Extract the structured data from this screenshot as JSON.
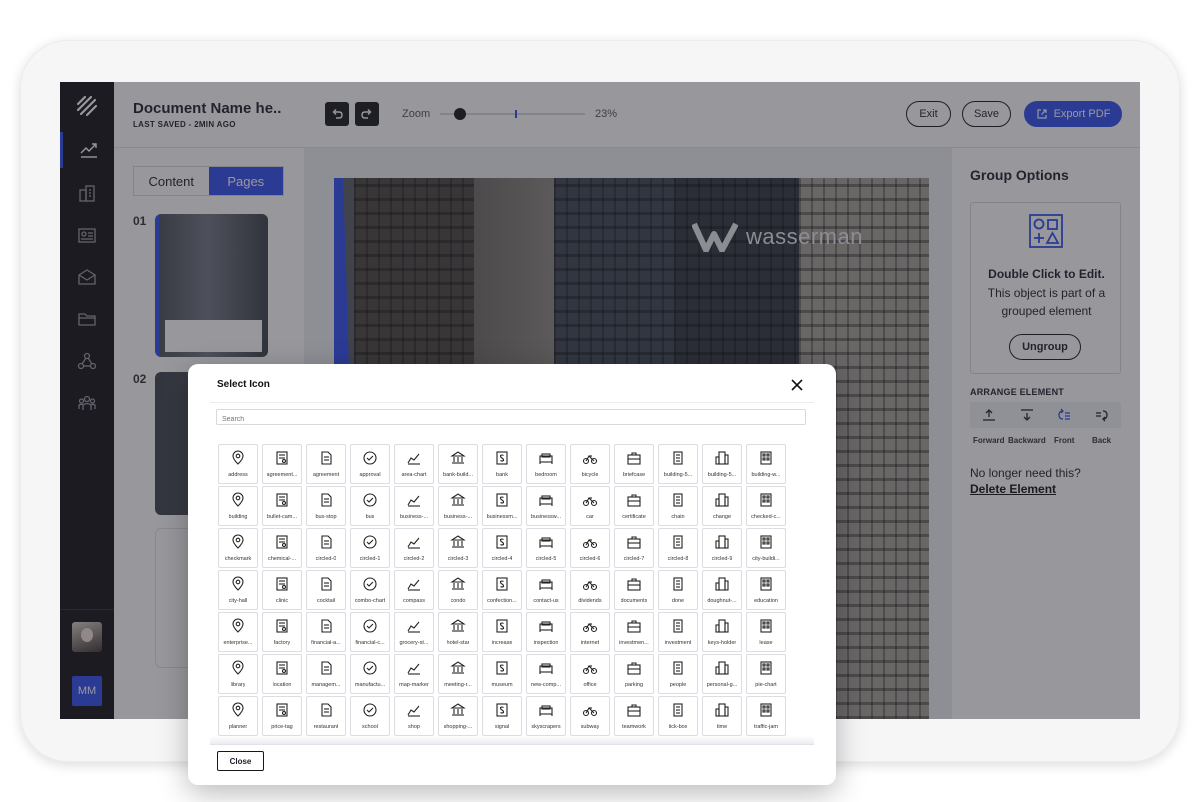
{
  "document": {
    "title": "Document Name he..",
    "saved": "LAST SAVED - 2MIN AGO"
  },
  "toolbar": {
    "undo_icon": "undo-icon",
    "redo_icon": "redo-icon",
    "zoom_label": "Zoom",
    "zoom_value": "23%",
    "zoom_fraction": 0.23,
    "exit": "Exit",
    "save": "Save",
    "export": "Export PDF"
  },
  "sidebar": {
    "initials": "MM",
    "items": [
      "analytics-icon",
      "buildings-icon",
      "listing-icon",
      "mail-icon",
      "folder-icon",
      "network-icon",
      "team-icon"
    ]
  },
  "left_panel": {
    "tabs": [
      "Content",
      "Pages"
    ],
    "active_tab": "Pages",
    "page_numbers": [
      "01",
      "02"
    ]
  },
  "canvas": {
    "brand": "wasserman"
  },
  "group_options": {
    "title": "Group Options",
    "edit_title": "Double Click to Edit.",
    "edit_desc": "This object is part of a grouped element",
    "ungroup": "Ungroup",
    "arrange_title": "ARRANGE ELEMENT",
    "arrange": [
      "Forward",
      "Backward",
      "Front",
      "Back"
    ],
    "no_longer": "No longer need this?",
    "delete": "Delete Element"
  },
  "modal": {
    "title": "Select Icon",
    "search_placeholder": "Search",
    "close_button": "Close",
    "icons": [
      "address",
      "agreement...",
      "agreement",
      "approval",
      "area-chart",
      "bank-build...",
      "bank",
      "bedroom",
      "bicycle",
      "briefcase",
      "building-5...",
      "building-5...",
      "building-w...",
      "building",
      "bullet-cam...",
      "bus-stop",
      "bus",
      "business-...",
      "business-...",
      "businessm...",
      "businessw...",
      "car",
      "certificate",
      "chain",
      "change",
      "checked-c...",
      "checkmark",
      "chemical-...",
      "circled-0",
      "circled-1",
      "circled-2",
      "circled-3",
      "circled-4",
      "circled-5",
      "circled-6",
      "circled-7",
      "circled-8",
      "circled-9",
      "city-buildi...",
      "city-hall",
      "clinic",
      "cocktail",
      "combo-chart",
      "compass",
      "condo",
      "confection...",
      "contact-us",
      "dividends",
      "documents",
      "done",
      "doughnut-...",
      "education",
      "enterprise...",
      "factory",
      "financial-a...",
      "financial-c...",
      "grocery-st...",
      "hotel-star",
      "increase",
      "inspection",
      "internet",
      "investmen...",
      "investment",
      "keys-holder",
      "lease",
      "library",
      "location",
      "managem...",
      "manufactu...",
      "map-marker",
      "meeting-r...",
      "museum",
      "new-comp...",
      "office",
      "parking",
      "people",
      "personal-g...",
      "pie-chart",
      "planner",
      "price-tag",
      "restaurant",
      "school",
      "shop",
      "shopping-...",
      "signal",
      "skyscrapers",
      "subway",
      "teamwork",
      "tick-box",
      "time",
      "traffic-jam"
    ]
  }
}
